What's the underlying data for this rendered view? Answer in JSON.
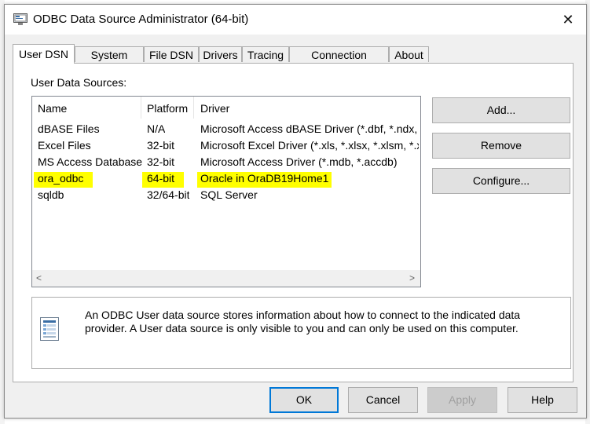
{
  "window": {
    "title": "ODBC Data Source Administrator (64-bit)",
    "close_glyph": "✕"
  },
  "tabs": [
    {
      "label": "User DSN",
      "active": true
    },
    {
      "label": "System DSN"
    },
    {
      "label": "File DSN"
    },
    {
      "label": "Drivers"
    },
    {
      "label": "Tracing"
    },
    {
      "label": "Connection Pooling"
    },
    {
      "label": "About"
    }
  ],
  "user_dsn": {
    "section_label": "User Data Sources:",
    "columns": [
      "Name",
      "Platform",
      "Driver"
    ],
    "rows": [
      {
        "name": "dBASE Files",
        "platform": "N/A",
        "driver": "Microsoft Access dBASE Driver (*.dbf, *.ndx, *.m"
      },
      {
        "name": "Excel Files",
        "platform": "32-bit",
        "driver": "Microsoft Excel Driver (*.xls, *.xlsx, *.xlsm, *.xlsb"
      },
      {
        "name": "MS Access Database",
        "platform": "32-bit",
        "driver": "Microsoft Access Driver (*.mdb, *.accdb)"
      },
      {
        "name": "ora_odbc",
        "platform": "64-bit",
        "driver": "Oracle in OraDB19Home1"
      },
      {
        "name": "sqldb",
        "platform": "32/64-bit",
        "driver": "SQL Server"
      }
    ],
    "scroll_left": "<",
    "scroll_right": ">",
    "buttons": {
      "add": "Add...",
      "remove": "Remove",
      "configure": "Configure..."
    },
    "info_text": "An ODBC User data source stores information about how to connect to the indicated data provider.  A User data source is only visible to you and can only be used on this computer."
  },
  "footer": {
    "ok": "OK",
    "cancel": "Cancel",
    "apply": "Apply",
    "help": "Help"
  },
  "colors": {
    "highlight": "#ffff00",
    "default_button_border": "#0078d7"
  }
}
